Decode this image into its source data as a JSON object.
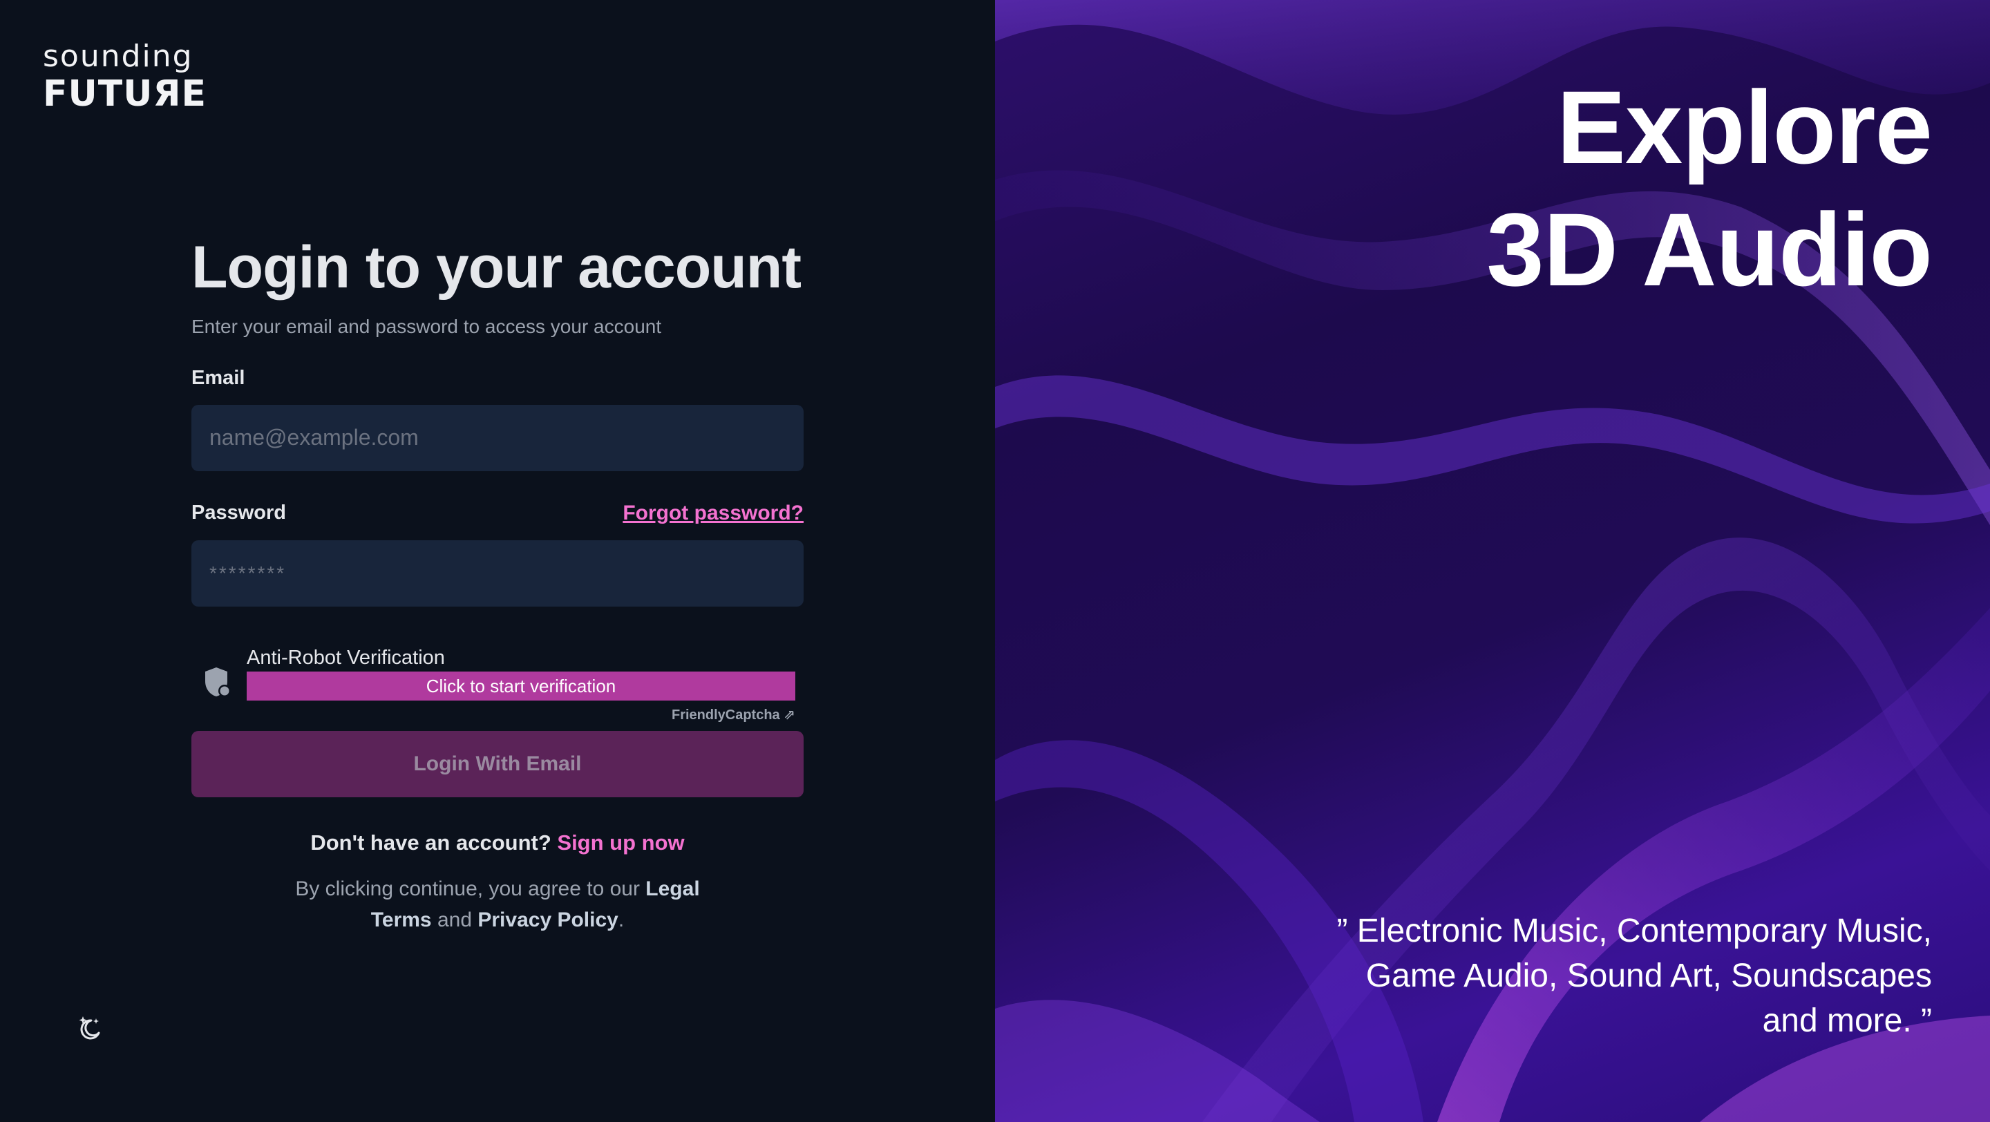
{
  "logo": {
    "line1": "sounding",
    "line2": "FUTUЯE"
  },
  "login": {
    "title": "Login to your account",
    "subtitle": "Enter your email and password to access your account",
    "email_label": "Email",
    "email_placeholder": "name@example.com",
    "password_label": "Password",
    "forgot_link": "Forgot password?",
    "password_placeholder": "********",
    "captcha_title": "Anti-Robot Verification",
    "captcha_button": "Click to start verification",
    "captcha_brand": "FriendlyCaptcha ⇗",
    "submit_label": "Login With Email",
    "signup_prompt": "Don't have an account?",
    "signup_link": "Sign up now",
    "terms_prefix": "By clicking continue, you agree to our",
    "terms_legal": "Legal Terms",
    "terms_and": "and",
    "terms_privacy": "Privacy Policy",
    "terms_period": "."
  },
  "hero": {
    "line1": "Explore",
    "line2": "3D Audio",
    "quote": "” Electronic Music, Contemporary Music, Game Audio, Sound Art, Soundscapes and more. ”"
  },
  "colors": {
    "left_bg": "#0b111c",
    "input_bg": "#18253b",
    "accent_pink": "#f472d0",
    "captcha_button": "#b03a9e",
    "login_button": "#5b2358"
  },
  "icons": {
    "captcha": "shield-icon",
    "theme": "moon-stars-icon"
  }
}
